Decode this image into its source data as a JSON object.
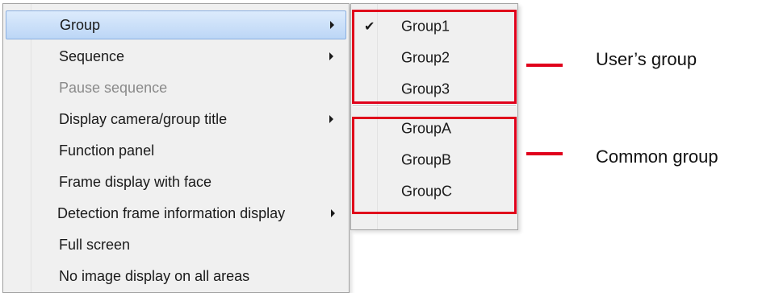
{
  "menu": {
    "items": [
      {
        "label": "Group",
        "has_submenu": true,
        "highlighted": true,
        "disabled": false
      },
      {
        "label": "Sequence",
        "has_submenu": true,
        "highlighted": false,
        "disabled": false
      },
      {
        "label": "Pause sequence",
        "has_submenu": false,
        "highlighted": false,
        "disabled": true
      },
      {
        "label": "Display camera/group title",
        "has_submenu": true,
        "highlighted": false,
        "disabled": false
      },
      {
        "label": "Function panel",
        "has_submenu": false,
        "highlighted": false,
        "disabled": false
      },
      {
        "label": "Frame display with face",
        "has_submenu": false,
        "highlighted": false,
        "disabled": false
      },
      {
        "label": "Detection frame information display",
        "has_submenu": true,
        "highlighted": false,
        "disabled": false
      },
      {
        "label": "Full screen",
        "has_submenu": false,
        "highlighted": false,
        "disabled": false
      },
      {
        "label": "No image display on all areas",
        "has_submenu": false,
        "highlighted": false,
        "disabled": false
      }
    ]
  },
  "submenu": {
    "users_groups": [
      {
        "label": "Group1",
        "checked": true,
        "check_glyph": "✔"
      },
      {
        "label": "Group2",
        "checked": false
      },
      {
        "label": "Group3",
        "checked": false
      }
    ],
    "common_groups": [
      {
        "label": "GroupA",
        "checked": false
      },
      {
        "label": "GroupB",
        "checked": false
      },
      {
        "label": "GroupC",
        "checked": false
      }
    ]
  },
  "annotations": {
    "users_group_label": "User’s group",
    "common_group_label": "Common group",
    "highlight_color": "#e0001b"
  },
  "icons": {
    "submenu_arrow": "chevron-right-icon",
    "checkmark": "checkmark-icon"
  }
}
